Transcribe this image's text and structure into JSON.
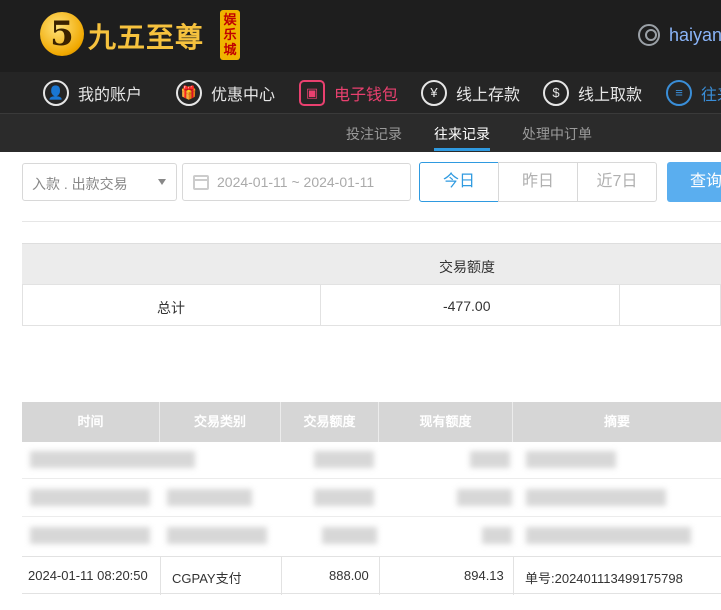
{
  "brand": {
    "logo_glyph": "5",
    "name": "九五至尊",
    "badge": "娱乐城",
    "accent": "#f6c23e"
  },
  "user": {
    "name": "haiyan"
  },
  "main_nav": [
    {
      "label": "我的账户",
      "icon": "user-icon"
    },
    {
      "label": "优惠中心",
      "icon": "gift-icon"
    },
    {
      "label": "电子钱包",
      "icon": "wallet-icon",
      "active": true
    },
    {
      "label": "线上存款",
      "icon": "deposit-icon"
    },
    {
      "label": "线上取款",
      "icon": "withdraw-icon"
    },
    {
      "label": "往来",
      "icon": "records-icon"
    }
  ],
  "sub_nav": [
    {
      "label": "投注记录"
    },
    {
      "label": "往来记录",
      "active": true
    },
    {
      "label": "处理中订单"
    }
  ],
  "filters": {
    "type_select": "入款 . 出款交易",
    "date_range": "2024-01-11 ~ 2024-01-11",
    "quick_ranges": [
      "今日",
      "昨日",
      "近7日"
    ],
    "active_range": "今日",
    "query_button": "查询"
  },
  "summary": {
    "header": "交易额度",
    "row_label": "总计",
    "total": "-477.00"
  },
  "table": {
    "columns": [
      "时间",
      "交易类别",
      "交易额度",
      "现有额度",
      "摘要"
    ],
    "rows": [
      {
        "time": "2024-01-11 08:20:50",
        "type": "CGPAY支付",
        "amount": "888.00",
        "balance": "894.13",
        "summary": "单号:202401113499175798"
      }
    ]
  }
}
